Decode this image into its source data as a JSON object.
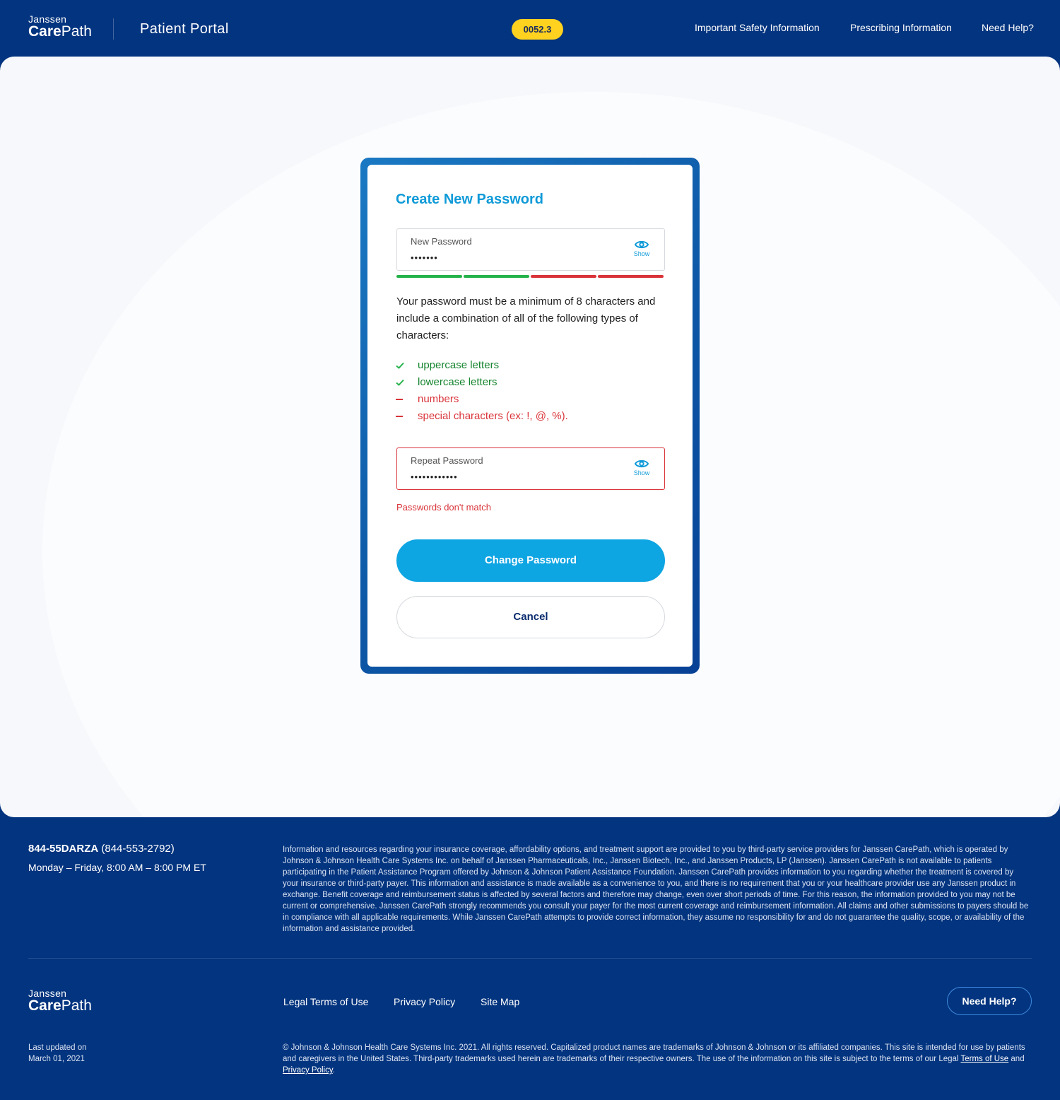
{
  "header": {
    "logo_small": "Janssen",
    "logo_big_bold": "Care",
    "logo_big_rest": "Path",
    "portal_title": "Patient Portal",
    "version_badge": "0052.3",
    "nav": {
      "safety": "Important Safety Information",
      "prescribing": "Prescribing Information",
      "help": "Need Help?"
    }
  },
  "form": {
    "title": "Create New Password",
    "new_password": {
      "label": "New Password",
      "value": "•••••••",
      "show_label": "Show"
    },
    "strength": {
      "level": 2,
      "total": 4,
      "colors": {
        "met": "#26b24b",
        "unmet": "#d9343a"
      }
    },
    "hint": "Your password must be a minimum of 8 characters and include a combination  of all of the following types of characters:",
    "rules": [
      {
        "text": "uppercase letters",
        "met": true
      },
      {
        "text": "lowercase letters",
        "met": true
      },
      {
        "text": "numbers",
        "met": false
      },
      {
        "text": "special characters  (ex: !, @, %).",
        "met": false
      }
    ],
    "repeat_password": {
      "label": "Repeat Password",
      "value": "••••••••••••",
      "show_label": "Show"
    },
    "error": "Passwords don't match",
    "submit_label": "Change Password",
    "cancel_label": "Cancel"
  },
  "footer": {
    "phone_bold": "844-55DARZA",
    "phone_rest": " (844-553-2792)",
    "hours": "Monday – Friday, 8:00 AM – 8:00 PM ET",
    "disclaimer": "Information and resources regarding your insurance coverage, affordability options, and treatment support are provided to you by third-party service providers for Janssen CarePath, which is operated by Johnson & Johnson Health Care Systems Inc. on behalf of Janssen Pharmaceuticals, Inc., Janssen Biotech, Inc., and Janssen Products, LP (Janssen). Janssen CarePath is not available to patients participating in the Patient Assistance Program offered by Johnson & Johnson Patient Assistance Foundation. Janssen CarePath provides information to you regarding whether the treatment is covered by your insurance or third-party payer. This information and assistance is made available as a convenience to you, and there is no requirement that you or your healthcare provider use any Janssen product in exchange. Benefit coverage and reimbursement status is affected by several factors and therefore may change, even over short periods of time. For this reason, the information provided to you may not be current or comprehensive. Janssen CarePath strongly recommends you consult your payer for the most current coverage and reimbursement information. All claims and other submissions to payers should be in compliance with all applicable requirements. While Janssen CarePath attempts to provide correct information, they assume no responsibility for and do not guarantee the quality, scope, or availability of the information and assistance provided.",
    "links": {
      "legal": "Legal Terms of Use",
      "privacy": "Privacy Policy",
      "sitemap": "Site Map"
    },
    "help_button": "Need Help?",
    "updated_line1": "Last updated on",
    "updated_line2": "March 01, 2021",
    "copyright": "© Johnson & Johnson Health Care Systems Inc. 2021. All rights reserved. Capitalized product names are trademarks of Johnson & Johnson or its affiliated companies. This site is intended for use by patients and caregivers in the United States. Third-party trademarks used herein are trademarks of their respective owners. The use of the information on this site is subject to the terms of our Legal",
    "copyright_link1": "Terms of Use",
    "copyright_and": " and ",
    "copyright_link2": "Privacy Policy",
    "copyright_end": "."
  }
}
